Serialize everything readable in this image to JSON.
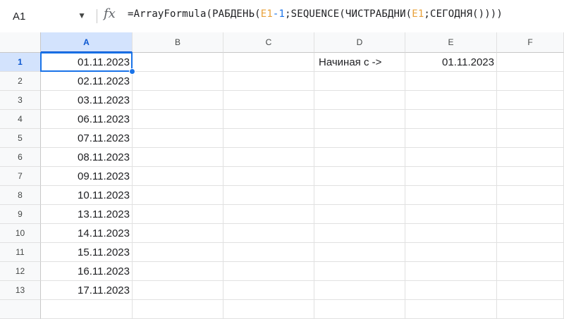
{
  "formula_bar": {
    "name_box": "A1",
    "name_box_icon": "caret-down-icon",
    "fx_label": "fx",
    "formula_parts": [
      {
        "text": "=ArrayFormula(РАБДЕНЬ(",
        "kind": "text"
      },
      {
        "text": "E1",
        "kind": "ref"
      },
      {
        "text": "-1",
        "kind": "num"
      },
      {
        "text": ";SEQUENCE(ЧИСТРАБДНИ(",
        "kind": "text"
      },
      {
        "text": "E1",
        "kind": "ref"
      },
      {
        "text": ";СЕГОДНЯ())))",
        "kind": "text"
      }
    ]
  },
  "sheet": {
    "columns": [
      "A",
      "B",
      "C",
      "D",
      "E",
      "F"
    ],
    "selected_column": "A",
    "selected_row": "1",
    "rows": [
      "1",
      "2",
      "3",
      "4",
      "5",
      "6",
      "7",
      "8",
      "9",
      "10",
      "11",
      "12",
      "13"
    ],
    "column_a": [
      "01.11.2023",
      "02.11.2023",
      "03.11.2023",
      "06.11.2023",
      "07.11.2023",
      "08.11.2023",
      "09.11.2023",
      "10.11.2023",
      "13.11.2023",
      "14.11.2023",
      "15.11.2023",
      "16.11.2023",
      "17.11.2023"
    ],
    "d1": "Начиная с ->",
    "e1": "01.11.2023"
  },
  "colors": {
    "selection": "#1a73e8",
    "header_selected_bg": "#d3e3fd",
    "reference": "#e8a13a",
    "number": "#1a73e8"
  }
}
